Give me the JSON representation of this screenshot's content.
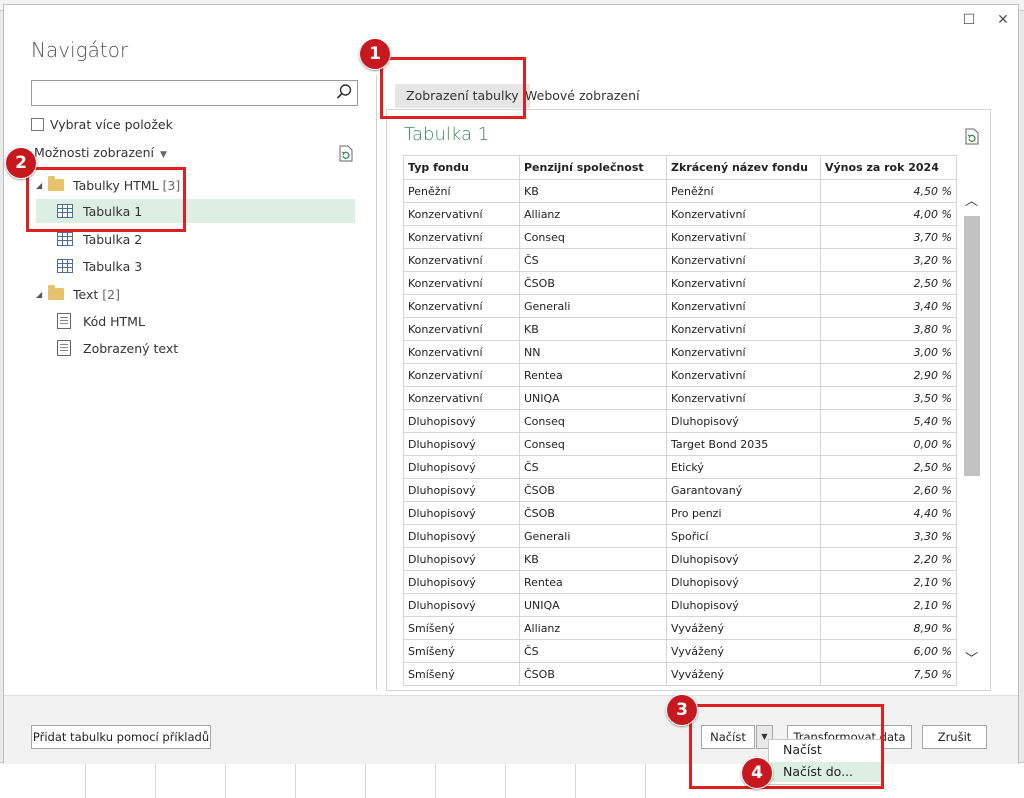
{
  "window": {
    "maximize_glyph": "☐",
    "close_glyph": "✕"
  },
  "navigator": {
    "title": "Navigátor",
    "search_placeholder": "",
    "multi_select_label": "Vybrat více položek",
    "view_options_label": "Možnosti zobrazení",
    "tree": {
      "group1": {
        "label": "Tabulky HTML",
        "count": "[3]"
      },
      "tables": [
        "Tabulka 1",
        "Tabulka 2",
        "Tabulka 3"
      ],
      "group2": {
        "label": "Text",
        "count": "[2]"
      },
      "texts": [
        "Kód HTML",
        "Zobrazený text"
      ]
    }
  },
  "preview": {
    "tabs": [
      "Zobrazení tabulky",
      "Webové zobrazení"
    ],
    "title": "Tabulka 1",
    "columns": [
      "Typ fondu",
      "Penzijní společnost",
      "Zkrácený název fondu",
      "Výnos za rok 2024"
    ],
    "rows": [
      [
        "Peněžní",
        "KB",
        "Peněžní",
        "4,50 %"
      ],
      [
        "Konzervativní",
        "Allianz",
        "Konzervativní",
        "4,00 %"
      ],
      [
        "Konzervativní",
        "Conseq",
        "Konzervativní",
        "3,70 %"
      ],
      [
        "Konzervativní",
        "ČS",
        "Konzervativní",
        "3,20 %"
      ],
      [
        "Konzervativní",
        "ČSOB",
        "Konzervativní",
        "2,50 %"
      ],
      [
        "Konzervativní",
        "Generali",
        "Konzervativní",
        "3,40 %"
      ],
      [
        "Konzervativní",
        "KB",
        "Konzervativní",
        "3,80 %"
      ],
      [
        "Konzervativní",
        "NN",
        "Konzervativní",
        "3,00 %"
      ],
      [
        "Konzervativní",
        "Rentea",
        "Konzervativní",
        "2,90 %"
      ],
      [
        "Konzervativní",
        "UNIQA",
        "Konzervativní",
        "3,50 %"
      ],
      [
        "Dluhopisový",
        "Conseq",
        "Dluhopisový",
        "5,40 %"
      ],
      [
        "Dluhopisový",
        "Conseq",
        "Target Bond 2035",
        "0,00 %"
      ],
      [
        "Dluhopisový",
        "ČS",
        "Etický",
        "2,50 %"
      ],
      [
        "Dluhopisový",
        "ČSOB",
        "Garantovaný",
        "2,60 %"
      ],
      [
        "Dluhopisový",
        "ČSOB",
        "Pro penzi",
        "4,40 %"
      ],
      [
        "Dluhopisový",
        "Generali",
        "Spořicí",
        "3,30 %"
      ],
      [
        "Dluhopisový",
        "KB",
        "Dluhopisový",
        "2,20 %"
      ],
      [
        "Dluhopisový",
        "Rentea",
        "Dluhopisový",
        "2,10 %"
      ],
      [
        "Dluhopisový",
        "UNIQA",
        "Dluhopisový",
        "2,10 %"
      ],
      [
        "Smíšený",
        "Allianz",
        "Vyvážený",
        "8,90 %"
      ],
      [
        "Smíšený",
        "ČS",
        "Vyvážený",
        "6,00 %"
      ],
      [
        "Smíšený",
        "ČSOB",
        "Vyvážený",
        "7,50 %"
      ]
    ]
  },
  "footer": {
    "add_table_label": "Přidat tabulku pomocí příkladů",
    "load_label": "Načíst",
    "transform_label": "Transformovat data",
    "cancel_label": "Zrušit",
    "load_menu": [
      "Načíst",
      "Načíst do..."
    ]
  },
  "annotations": [
    "1",
    "2",
    "3",
    "4"
  ],
  "colors": {
    "highlight": "#e02020",
    "badge": "#c8181f",
    "selection": "#ddefe2",
    "preview_title": "#3a8a5a"
  }
}
